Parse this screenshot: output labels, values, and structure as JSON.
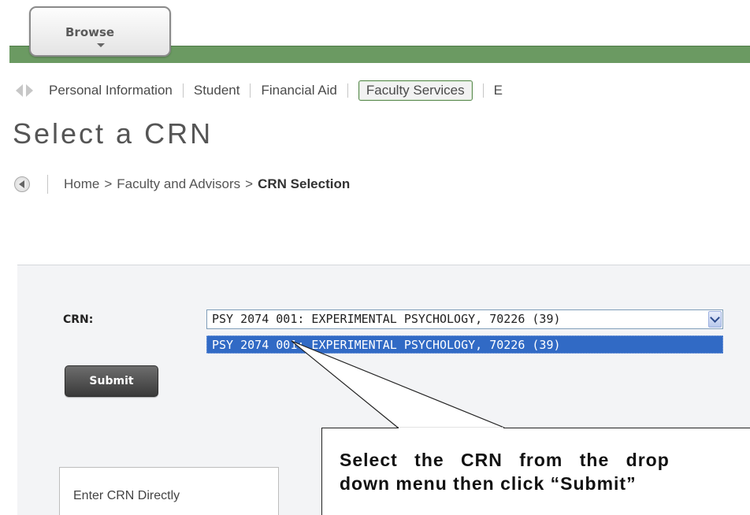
{
  "browse": {
    "label": "Browse"
  },
  "nav": {
    "items": [
      {
        "label": "Personal Information"
      },
      {
        "label": "Student"
      },
      {
        "label": "Financial Aid"
      },
      {
        "label": "Faculty Services"
      },
      {
        "label": "E"
      }
    ],
    "active": "Faculty Services"
  },
  "page": {
    "title": "Select a CRN"
  },
  "breadcrumb": {
    "home": "Home",
    "sep": ">",
    "parent": "Faculty and Advisors",
    "current": "CRN Selection"
  },
  "form": {
    "crn_label": "CRN:",
    "crn_value": "PSY 2074 001: EXPERIMENTAL PSYCHOLOGY, 70226 (39)",
    "options": [
      "PSY 2074 001: EXPERIMENTAL PSYCHOLOGY, 70226 (39)"
    ],
    "submit_label": "Submit",
    "enter_crn_label": "Enter CRN Directly"
  },
  "callout": {
    "line1": "Select the CRN from the drop",
    "line2": "down menu then click “Submit”"
  },
  "colors": {
    "green_bar": "#6b9a62",
    "selection_blue": "#316ac5"
  }
}
